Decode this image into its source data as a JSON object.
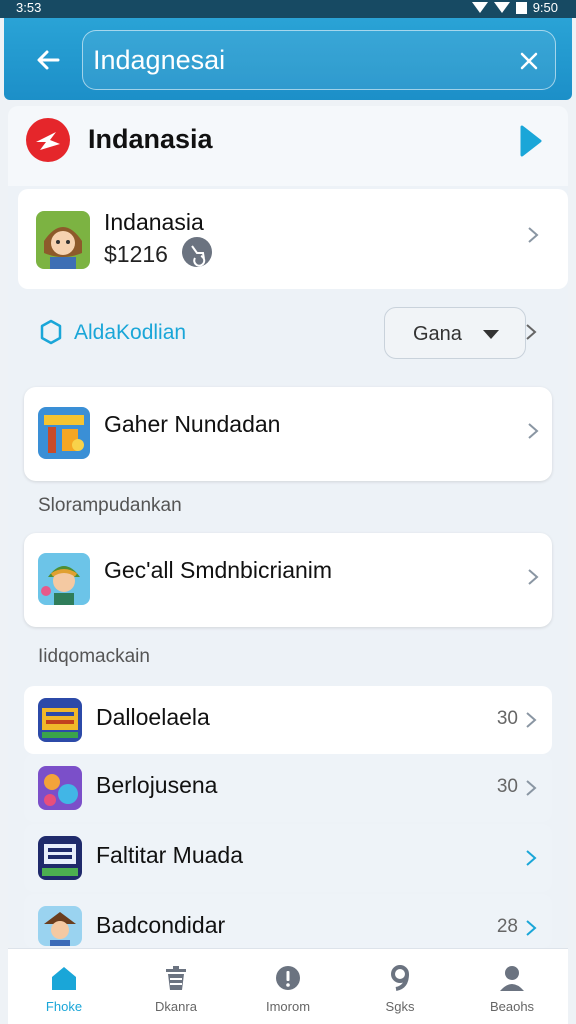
{
  "status_bar": {
    "time_left": "3:53",
    "time_right": "9:50"
  },
  "search": {
    "query": "Indagnesai"
  },
  "brand": {
    "title": "Indanasia"
  },
  "featured": {
    "name": "Indanasia",
    "price": "$1216"
  },
  "filter": {
    "label": "AldaKodlian",
    "dropdown_value": "Gana"
  },
  "cards": [
    {
      "name": "Gaher Nundadan"
    },
    {
      "name": "Gec'all Smdnbicrianim"
    }
  ],
  "sections": [
    {
      "label": "Slorampudankan"
    },
    {
      "label": "Iidqomackain"
    }
  ],
  "list": [
    {
      "name": "Dalloelaela",
      "count": "30"
    },
    {
      "name": "Berlojusena",
      "count": "30"
    },
    {
      "name": "Faltitar Muada",
      "count": ""
    },
    {
      "name": "Badcondidar",
      "count": "28"
    }
  ],
  "bottom_nav": [
    {
      "label": "Fhoke",
      "icon": "home-icon",
      "active": true
    },
    {
      "label": "Dkanra",
      "icon": "trash-icon",
      "active": false
    },
    {
      "label": "Imorom",
      "icon": "info-icon",
      "active": false
    },
    {
      "label": "Sgks",
      "icon": "nine-icon",
      "active": false
    },
    {
      "label": "Beaohs",
      "icon": "profile-icon",
      "active": false
    }
  ],
  "colors": {
    "header": "#1c8fc8",
    "accent": "#1aa6d8",
    "brand_red": "#e5262b",
    "background": "#edf2f7"
  }
}
